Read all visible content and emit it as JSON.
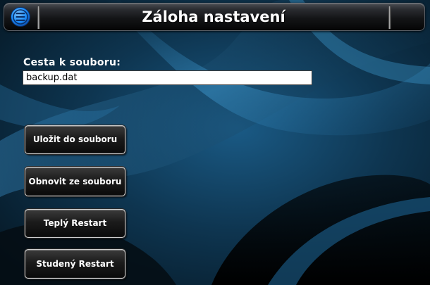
{
  "titlebar": {
    "title": "Záloha nastavení",
    "menu_icon": "menu-icon"
  },
  "backup": {
    "path_label": "Cesta k souboru:",
    "path_value": "backup.dat"
  },
  "actions": {
    "save_label": "Uložit do souboru",
    "restore_label": "Obnovit ze souboru",
    "warm_restart_label": "Teplý Restart",
    "cold_restart_label": "Studený Restart"
  },
  "colors": {
    "accent": "#1e90ff",
    "background": "#0b2233",
    "text": "#ffffff"
  }
}
